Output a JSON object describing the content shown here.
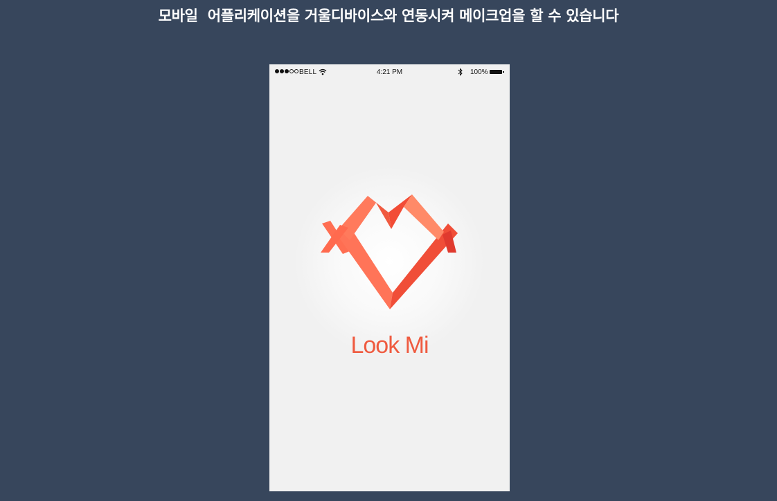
{
  "headline": "모바일  어플리케이션을 거울디바이스와 연동시켜 메이크업을 할 수 있습니다",
  "status_bar": {
    "signal_bars_filled": 3,
    "signal_bars_total": 5,
    "carrier": "BELL",
    "time": "4:21 PM",
    "battery_percent": "100%",
    "icons": [
      "wifi-icon",
      "bluetooth-icon",
      "battery-icon"
    ]
  },
  "app": {
    "name": "Look Mi",
    "logo_icon": "ribbon-heart-icon"
  },
  "colors": {
    "background": "#37465c",
    "screen": "#f1f1f1",
    "brand_orange": "#ef5a3f",
    "brand_light": "#ff7d5c",
    "brand_dark": "#d9402f"
  }
}
